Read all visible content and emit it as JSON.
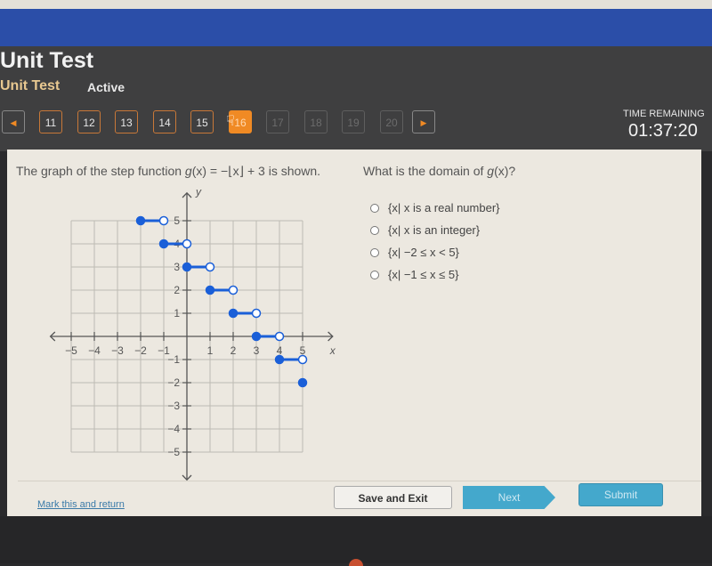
{
  "app": {
    "title": "Unit Test",
    "subtitle": "Unit Test",
    "status": "Active"
  },
  "nav": {
    "prev_icon": "triangle-left-icon",
    "next_icon": "triangle-right-icon",
    "questions": [
      {
        "label": "11",
        "state": "answered"
      },
      {
        "label": "12",
        "state": "answered"
      },
      {
        "label": "13",
        "state": "answered"
      },
      {
        "label": "14",
        "state": "answered"
      },
      {
        "label": "15",
        "state": "answered"
      },
      {
        "label": "16",
        "state": "current"
      },
      {
        "label": "17",
        "state": "disabled"
      },
      {
        "label": "18",
        "state": "disabled"
      },
      {
        "label": "19",
        "state": "disabled"
      },
      {
        "label": "20",
        "state": "disabled"
      }
    ]
  },
  "timer": {
    "label": "TIME REMAINING",
    "value": "01:37:20"
  },
  "question": {
    "text_prefix": "The graph of the step function ",
    "function_name": "g",
    "text_formula": "(x) = −⌊x⌋ + 3 is shown.",
    "prompt_prefix": "What is the domain of ",
    "prompt_fn": "g",
    "prompt_suffix": "(x)?",
    "options": [
      {
        "label": "{x| x is a real number}",
        "selected": false
      },
      {
        "label": "{x| x is an integer}",
        "selected": false
      },
      {
        "label": "{x| −2 ≤ x < 5}",
        "selected": false
      },
      {
        "label": "{x| −1 ≤ x ≤ 5}",
        "selected": false
      }
    ]
  },
  "chart_data": {
    "type": "line",
    "title": "g(x) = −⌊x⌋ + 3",
    "xlabel": "x",
    "ylabel": "y",
    "xlim": [
      -5,
      5
    ],
    "ylim": [
      -5,
      5
    ],
    "x_ticks": [
      "−5",
      "−4",
      "−3",
      "−2",
      "−1",
      "1",
      "2",
      "3",
      "4",
      "5"
    ],
    "y_ticks": [
      "5",
      "4",
      "3",
      "2",
      "1",
      "−1",
      "−2",
      "−3",
      "−4",
      "−5"
    ],
    "grid": true,
    "series_color": "#1a5fd8",
    "segments": [
      {
        "x_start": -2,
        "x_end": -1,
        "y": 5,
        "start_closed": true,
        "end_closed": false
      },
      {
        "x_start": -1,
        "x_end": 0,
        "y": 4,
        "start_closed": true,
        "end_closed": false
      },
      {
        "x_start": 0,
        "x_end": 1,
        "y": 3,
        "start_closed": true,
        "end_closed": false
      },
      {
        "x_start": 1,
        "x_end": 2,
        "y": 2,
        "start_closed": true,
        "end_closed": false
      },
      {
        "x_start": 2,
        "x_end": 3,
        "y": 1,
        "start_closed": true,
        "end_closed": false
      },
      {
        "x_start": 3,
        "x_end": 4,
        "y": 0,
        "start_closed": true,
        "end_closed": false
      },
      {
        "x_start": 4,
        "x_end": 5,
        "y": -1,
        "start_closed": true,
        "end_closed": false
      }
    ],
    "points": [
      {
        "x": 5,
        "y": -2,
        "closed": true
      }
    ]
  },
  "footer": {
    "mark_link": "Mark this and return",
    "save_label": "Save and Exit",
    "next_label": "Next",
    "submit_label": "Submit"
  }
}
